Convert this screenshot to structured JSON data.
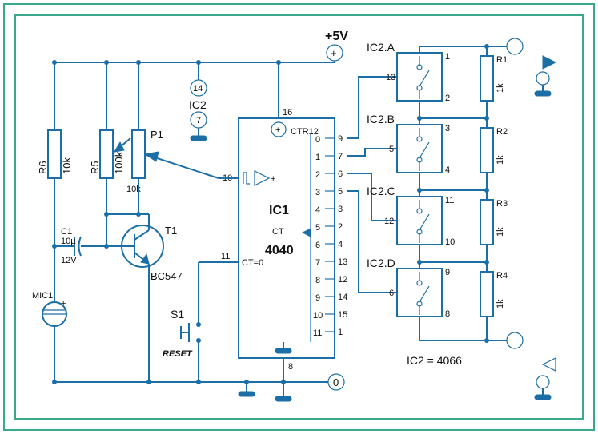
{
  "power": {
    "label": "+5V",
    "zero": "0"
  },
  "ic1": {
    "ref": "IC1",
    "part": "4040",
    "ctr": "CTR12",
    "ct": "CT",
    "ctzero": "CT=0",
    "pin_vcc": "16",
    "pin_gnd": "8",
    "pin_clk": "10",
    "pin_rst": "11",
    "q_nums": [
      "0",
      "1",
      "2",
      "3",
      "4",
      "5",
      "6",
      "7",
      "8",
      "9",
      "10",
      "11"
    ],
    "q_pins": [
      "9",
      "7",
      "6",
      "5",
      "3",
      "2",
      "4",
      "13",
      "12",
      "14",
      "15",
      "1"
    ]
  },
  "ic2": {
    "ref": "IC2",
    "vcc_pin": "14",
    "gnd_pin": "7",
    "eq": "IC2 = 4066",
    "a": {
      "ref": "IC2.A",
      "in": "1",
      "out": "2",
      "ctl": "13"
    },
    "b": {
      "ref": "IC2.B",
      "in": "3",
      "out": "4",
      "ctl": "5"
    },
    "c": {
      "ref": "IC2.C",
      "in": "11",
      "out": "10",
      "ctl": "12"
    },
    "d": {
      "ref": "IC2.D",
      "in": "9",
      "out": "8",
      "ctl": "6"
    }
  },
  "r": {
    "r1": {
      "ref": "R1",
      "val": "1k"
    },
    "r2": {
      "ref": "R2",
      "val": "1k"
    },
    "r3": {
      "ref": "R3",
      "val": "1k"
    },
    "r4": {
      "ref": "R4",
      "val": "1k"
    },
    "r5": {
      "ref": "R5",
      "val": "100k"
    },
    "r6": {
      "ref": "R6",
      "val": "10k"
    }
  },
  "p1": {
    "ref": "P1",
    "val": "10k"
  },
  "c1": {
    "ref": "C1",
    "val": "10µ",
    "volt": "12V"
  },
  "t1": {
    "ref": "T1",
    "part": "BC547"
  },
  "mic": {
    "ref": "MIC1"
  },
  "s1": {
    "ref": "S1",
    "label": "RESET"
  },
  "plus": "+"
}
